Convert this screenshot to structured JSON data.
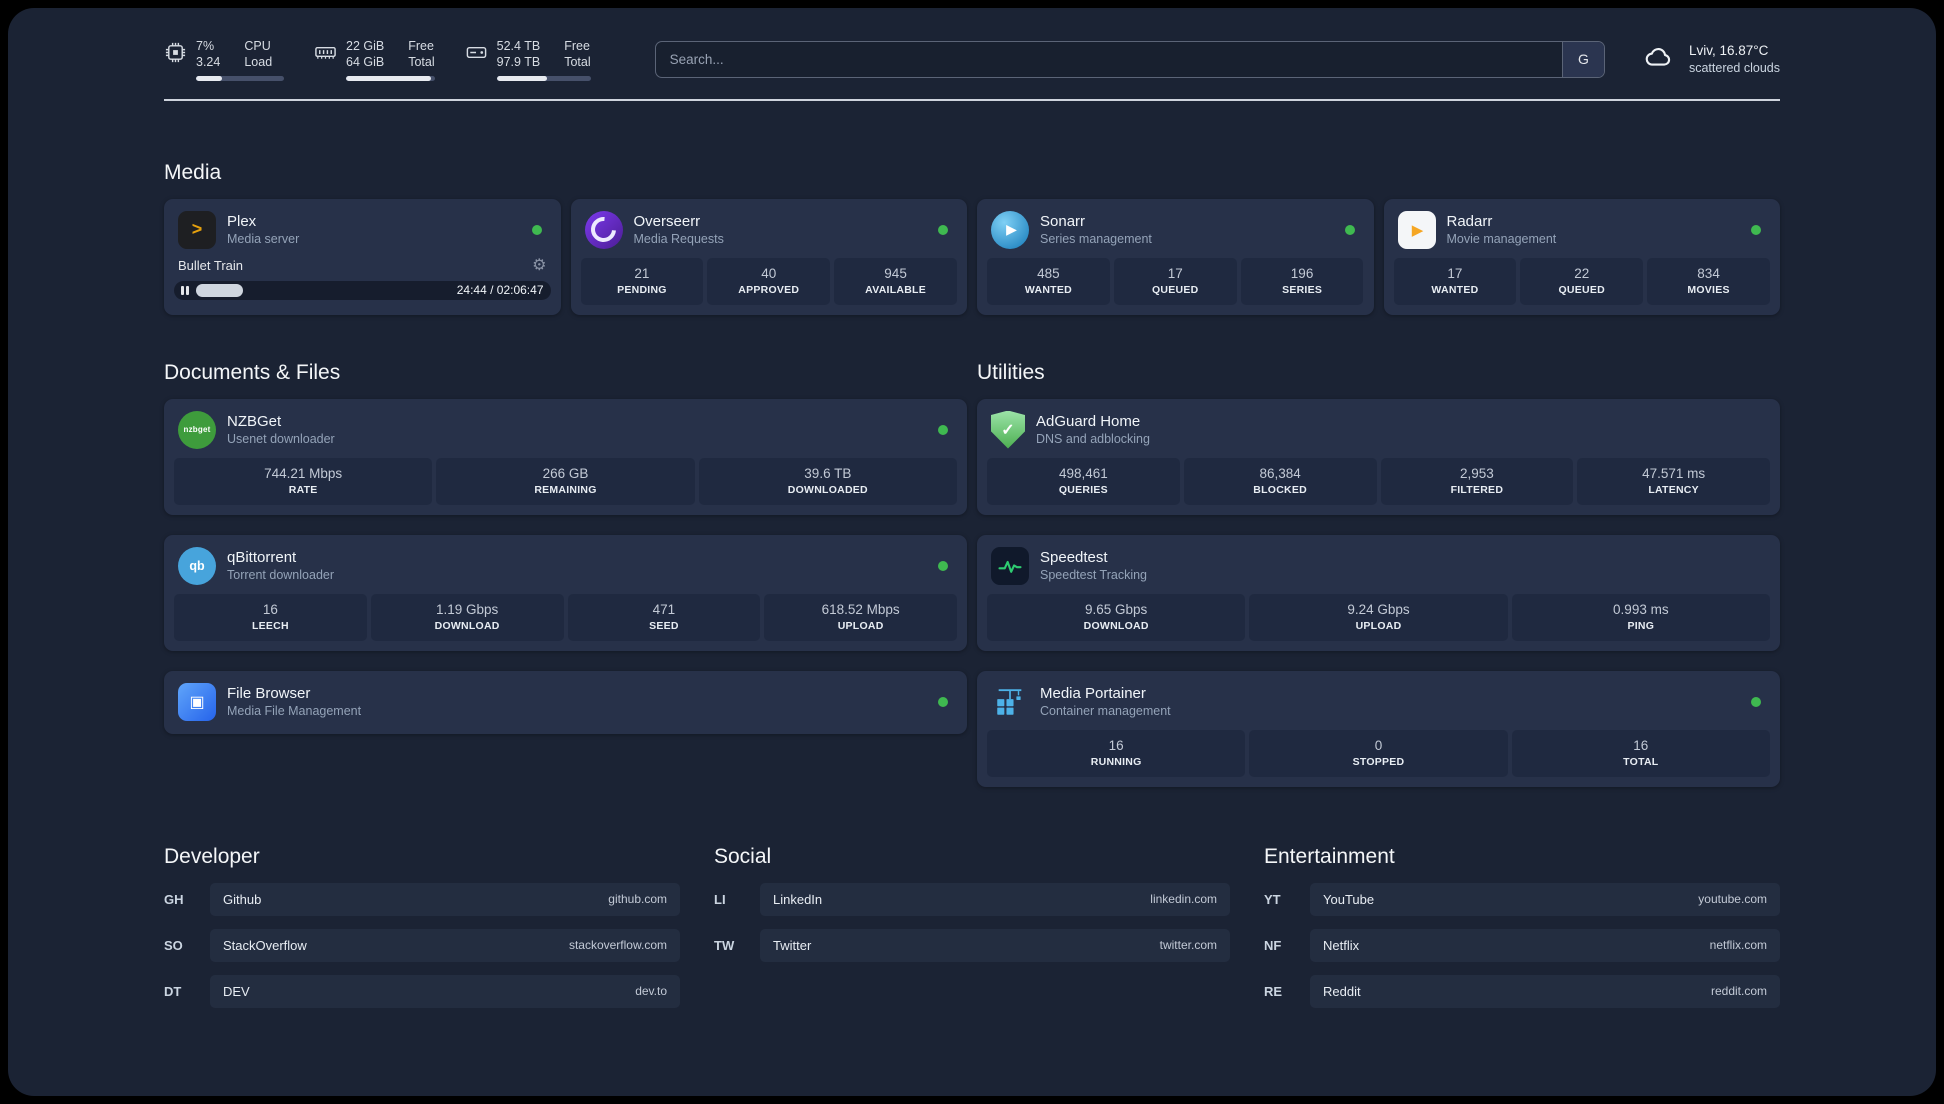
{
  "palette": {
    "page_bg": "#1b2334",
    "card_bg": "#273149",
    "tile_bg": "#1f2940",
    "status_online": "#3fb950",
    "plex_accent": "#e5a00d",
    "overseerr_purple": "#7c3aed",
    "sonarr_blue": "#1479b8",
    "radarr_amber": "#f5a623",
    "nzbget_green": "#3e9c3c",
    "qbittorrent_blue": "#47a4dc",
    "filebrowser_blue": "#2563eb",
    "adguard_green": "#4caf50",
    "speedtest_green": "#2ecc71",
    "portainer_blue": "#4db2e8"
  },
  "icons": {
    "plex_glyph": ">",
    "sonarr_glyph": "▶",
    "radarr_glyph": "▶",
    "nzbget_glyph": "nzbget",
    "qbittorrent_glyph": "qb",
    "filebrowser_glyph": "▣",
    "adguard_glyph": "✓",
    "gear_glyph": "⚙"
  },
  "topbar": {
    "cpu": {
      "value_top": "7%",
      "value_bottom": "3.24",
      "label_top": "CPU",
      "label_bottom": "Load",
      "bar_pct": 30
    },
    "memory": {
      "value_top": "22 GiB",
      "value_bottom": "64 GiB",
      "label_top": "Free",
      "label_bottom": "Total",
      "bar_pct": 96
    },
    "disk": {
      "value_top": "52.4 TB",
      "value_bottom": "97.9 TB",
      "label_top": "Free",
      "label_bottom": "Total",
      "bar_pct": 54
    },
    "search": {
      "placeholder": "Search...",
      "button_label": "G"
    },
    "weather": {
      "location": "Lviv, 16.87°C",
      "condition": "scattered clouds"
    }
  },
  "sections": {
    "media": {
      "title": "Media",
      "apps": [
        {
          "name": "Plex",
          "desc": "Media server",
          "online": true,
          "player": {
            "track": "Bullet Train",
            "time": "24:44 / 02:06:47",
            "progress_pct": 19
          }
        },
        {
          "name": "Overseerr",
          "desc": "Media Requests",
          "online": true,
          "stats": [
            {
              "value": "21",
              "label": "PENDING"
            },
            {
              "value": "40",
              "label": "APPROVED"
            },
            {
              "value": "945",
              "label": "AVAILABLE"
            }
          ]
        },
        {
          "name": "Sonarr",
          "desc": "Series management",
          "online": true,
          "stats": [
            {
              "value": "485",
              "label": "WANTED"
            },
            {
              "value": "17",
              "label": "QUEUED"
            },
            {
              "value": "196",
              "label": "SERIES"
            }
          ]
        },
        {
          "name": "Radarr",
          "desc": "Movie management",
          "online": true,
          "stats": [
            {
              "value": "17",
              "label": "WANTED"
            },
            {
              "value": "22",
              "label": "QUEUED"
            },
            {
              "value": "834",
              "label": "MOVIES"
            }
          ]
        }
      ]
    },
    "documents": {
      "title": "Documents & Files",
      "apps": [
        {
          "name": "NZBGet",
          "desc": "Usenet downloader",
          "online": true,
          "stats": [
            {
              "value": "744.21 Mbps",
              "label": "RATE"
            },
            {
              "value": "266 GB",
              "label": "REMAINING"
            },
            {
              "value": "39.6 TB",
              "label": "DOWNLOADED"
            }
          ]
        },
        {
          "name": "qBittorrent",
          "desc": "Torrent downloader",
          "online": true,
          "stats": [
            {
              "value": "16",
              "label": "LEECH"
            },
            {
              "value": "1.19 Gbps",
              "label": "DOWNLOAD"
            },
            {
              "value": "471",
              "label": "SEED"
            },
            {
              "value": "618.52 Mbps",
              "label": "UPLOAD"
            }
          ]
        },
        {
          "name": "File Browser",
          "desc": "Media File Management",
          "online": true,
          "stats": []
        }
      ]
    },
    "utilities": {
      "title": "Utilities",
      "apps": [
        {
          "name": "AdGuard Home",
          "desc": "DNS and adblocking",
          "online": false,
          "stats": [
            {
              "value": "498,461",
              "label": "QUERIES"
            },
            {
              "value": "86,384",
              "label": "BLOCKED"
            },
            {
              "value": "2,953",
              "label": "FILTERED"
            },
            {
              "value": "47.571 ms",
              "label": "LATENCY"
            }
          ]
        },
        {
          "name": "Speedtest",
          "desc": "Speedtest Tracking",
          "online": false,
          "stats": [
            {
              "value": "9.65 Gbps",
              "label": "DOWNLOAD"
            },
            {
              "value": "9.24 Gbps",
              "label": "UPLOAD"
            },
            {
              "value": "0.993 ms",
              "label": "PING"
            }
          ]
        },
        {
          "name": "Media Portainer",
          "desc": "Container management",
          "online": true,
          "stats": [
            {
              "value": "16",
              "label": "RUNNING"
            },
            {
              "value": "0",
              "label": "STOPPED"
            },
            {
              "value": "16",
              "label": "TOTAL"
            }
          ]
        }
      ]
    },
    "bookmarks": [
      {
        "title": "Developer",
        "items": [
          {
            "abbr": "GH",
            "name": "Github",
            "domain": "github.com"
          },
          {
            "abbr": "SO",
            "name": "StackOverflow",
            "domain": "stackoverflow.com"
          },
          {
            "abbr": "DT",
            "name": "DEV",
            "domain": "dev.to"
          }
        ]
      },
      {
        "title": "Social",
        "items": [
          {
            "abbr": "LI",
            "name": "LinkedIn",
            "domain": "linkedin.com"
          },
          {
            "abbr": "TW",
            "name": "Twitter",
            "domain": "twitter.com"
          }
        ]
      },
      {
        "title": "Entertainment",
        "items": [
          {
            "abbr": "YT",
            "name": "YouTube",
            "domain": "youtube.com"
          },
          {
            "abbr": "NF",
            "name": "Netflix",
            "domain": "netflix.com"
          },
          {
            "abbr": "RE",
            "name": "Reddit",
            "domain": "reddit.com"
          }
        ]
      }
    ]
  }
}
